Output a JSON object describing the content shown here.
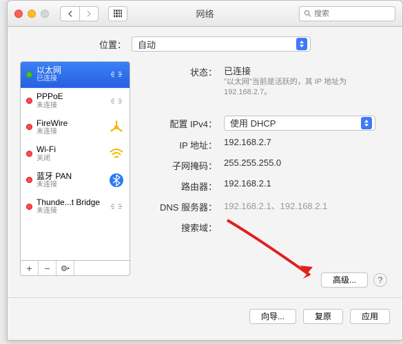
{
  "window": {
    "title": "网络"
  },
  "search": {
    "placeholder": "搜索"
  },
  "location": {
    "label": "位置：",
    "value": "自动"
  },
  "sidebar": {
    "items": [
      {
        "name": "以太网",
        "sub": "已连接",
        "dot": "green",
        "selected": true,
        "icon": "ethernet"
      },
      {
        "name": "PPPoE",
        "sub": "未连接",
        "dot": "red",
        "selected": false,
        "icon": "ethernet"
      },
      {
        "name": "FireWire",
        "sub": "未连接",
        "dot": "red",
        "selected": false,
        "icon": "firewire"
      },
      {
        "name": "Wi-Fi",
        "sub": "关闭",
        "dot": "red",
        "selected": false,
        "icon": "wifi"
      },
      {
        "name": "蓝牙 PAN",
        "sub": "未连接",
        "dot": "red",
        "selected": false,
        "icon": "bluetooth"
      },
      {
        "name": "Thunde...t Bridge",
        "sub": "未连接",
        "dot": "red",
        "selected": false,
        "icon": "ethernet"
      }
    ]
  },
  "details": {
    "status_label": "状态：",
    "status_value": "已连接",
    "status_desc": "\"以太网\"当前是活跃的，其 IP 地址为 192.168.2.7。",
    "config_label": "配置 IPv4：",
    "config_value": "使用 DHCP",
    "ip_label": "IP 地址：",
    "ip_value": "192.168.2.7",
    "mask_label": "子网掩码：",
    "mask_value": "255.255.255.0",
    "router_label": "路由器：",
    "router_value": "192.168.2.1",
    "dns_label": "DNS 服务器：",
    "dns_value": "192.168.2.1、192.168.2.1",
    "search_label": "搜索域：",
    "advanced": "高级..."
  },
  "footer": {
    "wizard": "向导...",
    "revert": "复原",
    "apply": "应用"
  }
}
